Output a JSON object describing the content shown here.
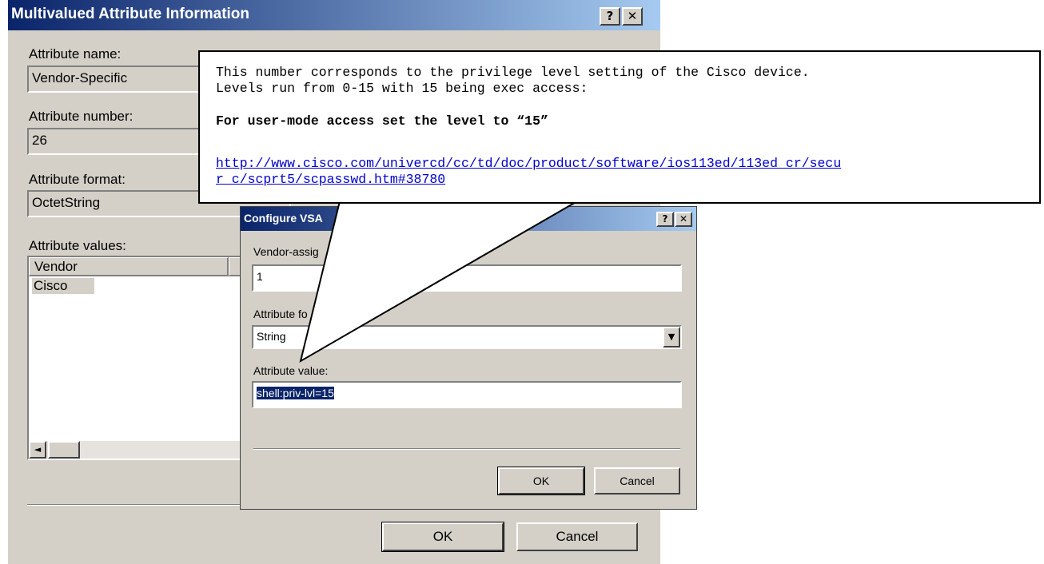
{
  "main_dialog": {
    "title": "Multivalued Attribute Information",
    "help_glyph": "?",
    "close_glyph": "✕",
    "attribute_name_label": "Attribute name:",
    "attribute_name_value": "Vendor-Specific",
    "attribute_number_label": "Attribute number:",
    "attribute_number_value": "26",
    "attribute_format_label": "Attribute format:",
    "attribute_format_value": "OctetString",
    "attribute_values_label": "Attribute values:",
    "columns": [
      "Vendor"
    ],
    "rows": [
      {
        "vendor": "Cisco"
      }
    ],
    "scroll_left_glyph": "◄",
    "ok_label": "OK",
    "cancel_label": "Cancel"
  },
  "vsa_dialog": {
    "title": "Configure VSA",
    "help_glyph": "?",
    "close_glyph": "✕",
    "vendor_assigned_label": "Vendor-assig",
    "vendor_assigned_value": "1",
    "attribute_format_label": "Attribute fo",
    "attribute_format_value": "String",
    "dropdown_glyph": "▼",
    "attribute_value_label": "Attribute value:",
    "attribute_value_value": "shell:priv-lvl=15",
    "ok_label": "OK",
    "cancel_label": "Cancel"
  },
  "callout": {
    "line1": "This number corresponds to the privilege level setting of the Cisco device.",
    "line2": "Levels run from 0-15 with 15 being exec access:",
    "bold_line": "For user-mode access set the level to “15”",
    "link_line1": "http://www.cisco.com/univercd/cc/td/doc/product/software/ios113ed/113ed_cr/secu",
    "link_line2": "r_c/scprt5/scpasswd.htm#38780"
  },
  "colors": {
    "title_start": "#0a246a",
    "title_end": "#a6caf0",
    "dialog_face": "#d4d0c8",
    "link": "#0000cc"
  }
}
